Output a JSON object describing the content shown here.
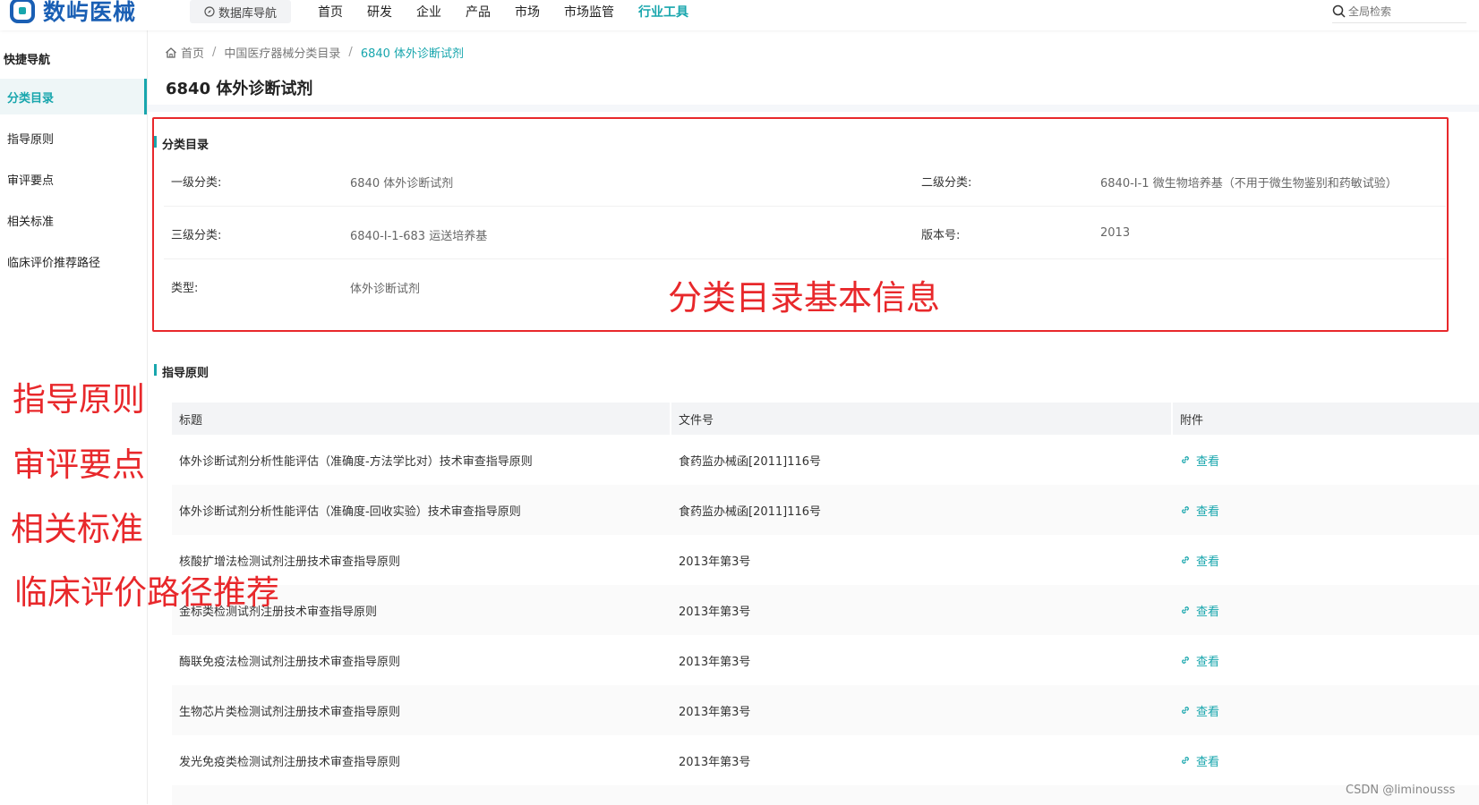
{
  "brand": {
    "name": "数屿医械",
    "color": "#1a5fb4",
    "accent": "#18a6ad"
  },
  "header": {
    "db_nav_label": "数据库导航",
    "nav": [
      "首页",
      "研发",
      "企业",
      "产品",
      "市场",
      "市场监管",
      "行业工具"
    ],
    "active_nav": "行业工具",
    "search_placeholder": "全局检索"
  },
  "sidebar": {
    "title": "快捷导航",
    "items": [
      {
        "label": "分类目录",
        "active": true
      },
      {
        "label": "指导原则"
      },
      {
        "label": "审评要点"
      },
      {
        "label": "相关标准"
      },
      {
        "label": "临床评价推荐路径"
      }
    ]
  },
  "breadcrumb": {
    "home": "首页",
    "level1": "中国医疗器械分类目录",
    "current": "6840 体外诊断试剂"
  },
  "page_title": "6840 体外诊断试剂",
  "catalog": {
    "title": "分类目录",
    "first_label": "一级分类:",
    "first_value": "6840 体外诊断试剂",
    "second_label": "二级分类:",
    "second_value": "6840-Ⅰ-1 微生物培养基（不用于微生物鉴别和药敏试验）",
    "third_label": "三级分类:",
    "third_value": "6840-Ⅰ-1-683 运送培养基",
    "version_label": "版本号:",
    "version_value": "2013",
    "type_label": "类型:",
    "type_value": "体外诊断试剂"
  },
  "guidelines": {
    "title": "指导原则",
    "columns": [
      "标题",
      "文件号",
      "附件"
    ],
    "link_label": "查看",
    "rows": [
      {
        "title": "体外诊断试剂分析性能评估（准确度-方法学比对）技术审查指导原则",
        "doc": "食药监办械函[2011]116号"
      },
      {
        "title": "体外诊断试剂分析性能评估（准确度-回收实验）技术审查指导原则",
        "doc": "食药监办械函[2011]116号"
      },
      {
        "title": "核酸扩增法检测试剂注册技术审查指导原则",
        "doc": "2013年第3号"
      },
      {
        "title": "金标类检测试剂注册技术审查指导原则",
        "doc": "2013年第3号"
      },
      {
        "title": "酶联免疫法检测试剂注册技术审查指导原则",
        "doc": "2013年第3号"
      },
      {
        "title": "生物芯片类检测试剂注册技术审查指导原则",
        "doc": "2013年第3号"
      },
      {
        "title": "发光免疫类检测试剂注册技术审查指导原则",
        "doc": "2013年第3号"
      }
    ]
  },
  "annotations": {
    "box_label": "分类目录基本信息",
    "side": [
      "指导原则",
      "审评要点",
      "相关标准",
      "临床评价路径推荐"
    ],
    "color": "#e8282b"
  },
  "watermark": "CSDN @liminousss"
}
